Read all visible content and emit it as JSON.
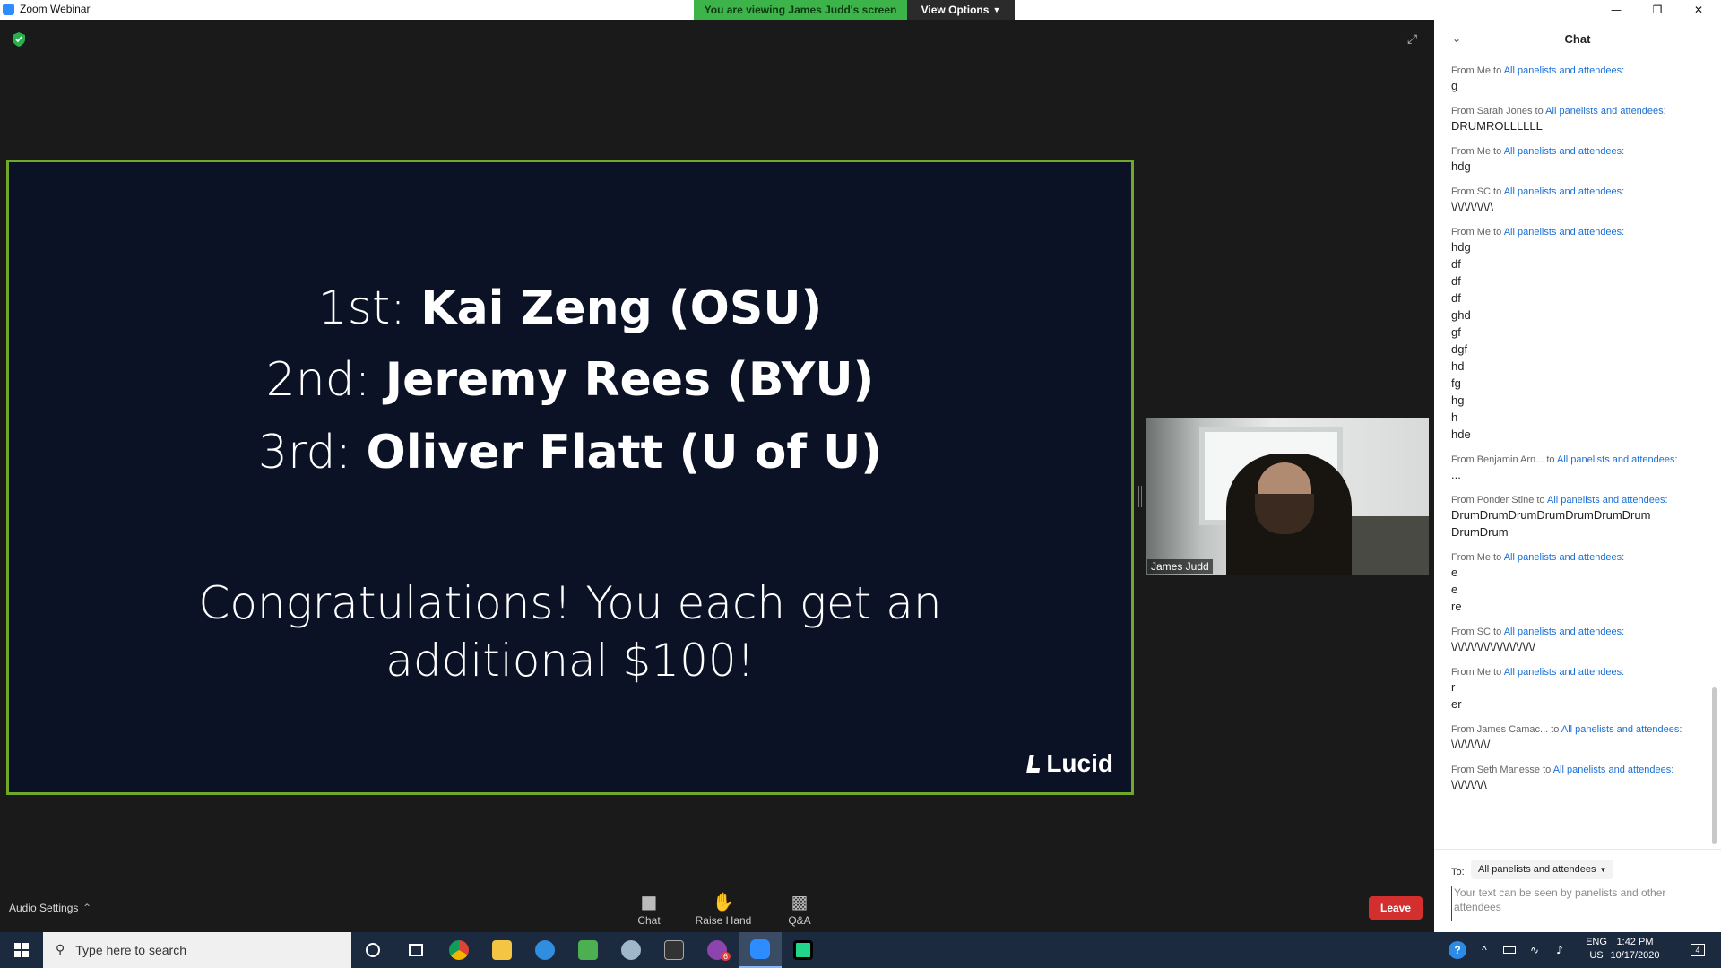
{
  "window": {
    "title": "Zoom Webinar",
    "viewing_banner": "You are viewing James Judd's screen",
    "view_options": "View Options"
  },
  "slide": {
    "places": [
      {
        "label": "1st:",
        "name": "Kai Zeng (OSU)"
      },
      {
        "label": "2nd:",
        "name": "Jeremy Rees (BYU)"
      },
      {
        "label": "3rd:",
        "name": "Oliver Flatt (U of U)"
      }
    ],
    "congrats_line1": "Congratulations! You each get an",
    "congrats_line2": "additional $100!",
    "logo": "Lucid"
  },
  "video": {
    "participant_name": "James Judd"
  },
  "toolbar": {
    "audio_settings": "Audio Settings",
    "chat": "Chat",
    "raise_hand": "Raise Hand",
    "qa": "Q&A",
    "leave": "Leave"
  },
  "chat": {
    "title": "Chat",
    "to_label": "To:",
    "recipient": "All panelists and attendees",
    "input_placeholder": "Your text can be seen by panelists and other attendees",
    "messages": [
      {
        "from": "From Me to ",
        "to": "All panelists and attendees:",
        "lines": [
          "g"
        ]
      },
      {
        "from": "From Sarah Jones to ",
        "to": "All panelists and attendees:",
        "lines": [
          "DRUMROLLLLLL"
        ]
      },
      {
        "from": "From Me to ",
        "to": "All panelists and attendees:",
        "lines": [
          "hdg"
        ]
      },
      {
        "from": "From SC to ",
        "to": "All panelists and attendees:",
        "lines": [
          "\\/\\/\\/\\/\\/\\/\\"
        ]
      },
      {
        "from": "From Me to ",
        "to": "All panelists and attendees:",
        "lines": [
          "hdg",
          "df",
          "df",
          "df",
          "ghd",
          "gf",
          "dgf",
          "hd",
          "fg",
          "hg",
          "h",
          "hde"
        ]
      },
      {
        "from": "From Benjamin Arn... to ",
        "to": "All panelists and attendees:",
        "lines": [
          "..."
        ]
      },
      {
        "from": "From Ponder Stine to ",
        "to": "All panelists and attendees:",
        "lines": [
          "DrumDrumDrumDrumDrumDrumDrum",
          "DrumDrum"
        ]
      },
      {
        "from": "From Me to ",
        "to": "All panelists and attendees:",
        "lines": [
          "e",
          "e",
          "re"
        ]
      },
      {
        "from": "From SC to ",
        "to": "All panelists and attendees:",
        "lines": [
          "\\/\\/\\/\\/\\/\\/\\/\\/\\/\\/\\/\\/\\/"
        ]
      },
      {
        "from": "From Me to ",
        "to": "All panelists and attendees:",
        "lines": [
          "r",
          "er"
        ]
      },
      {
        "from": "From James Camac... to ",
        "to": "All panelists and attendees:",
        "lines": [
          "\\/\\/\\/\\/\\/\\/"
        ]
      },
      {
        "from": "From Seth Manesse to ",
        "to": "All panelists and attendees:",
        "lines": [
          "\\/\\/\\/\\/\\/\\"
        ]
      }
    ]
  },
  "taskbar": {
    "search_placeholder": "Type here to search",
    "lang_line1": "ENG",
    "lang_line2": "US",
    "time": "1:42 PM",
    "date": "10/17/2020",
    "notification_count": "4",
    "app_badge": "6"
  },
  "colors": {
    "zoom_blue": "#2D8CFF",
    "banner_green": "#3db44a",
    "slide_border": "#6fa82a",
    "leave_red": "#d32f2f",
    "link_blue": "#1a6fd6"
  }
}
